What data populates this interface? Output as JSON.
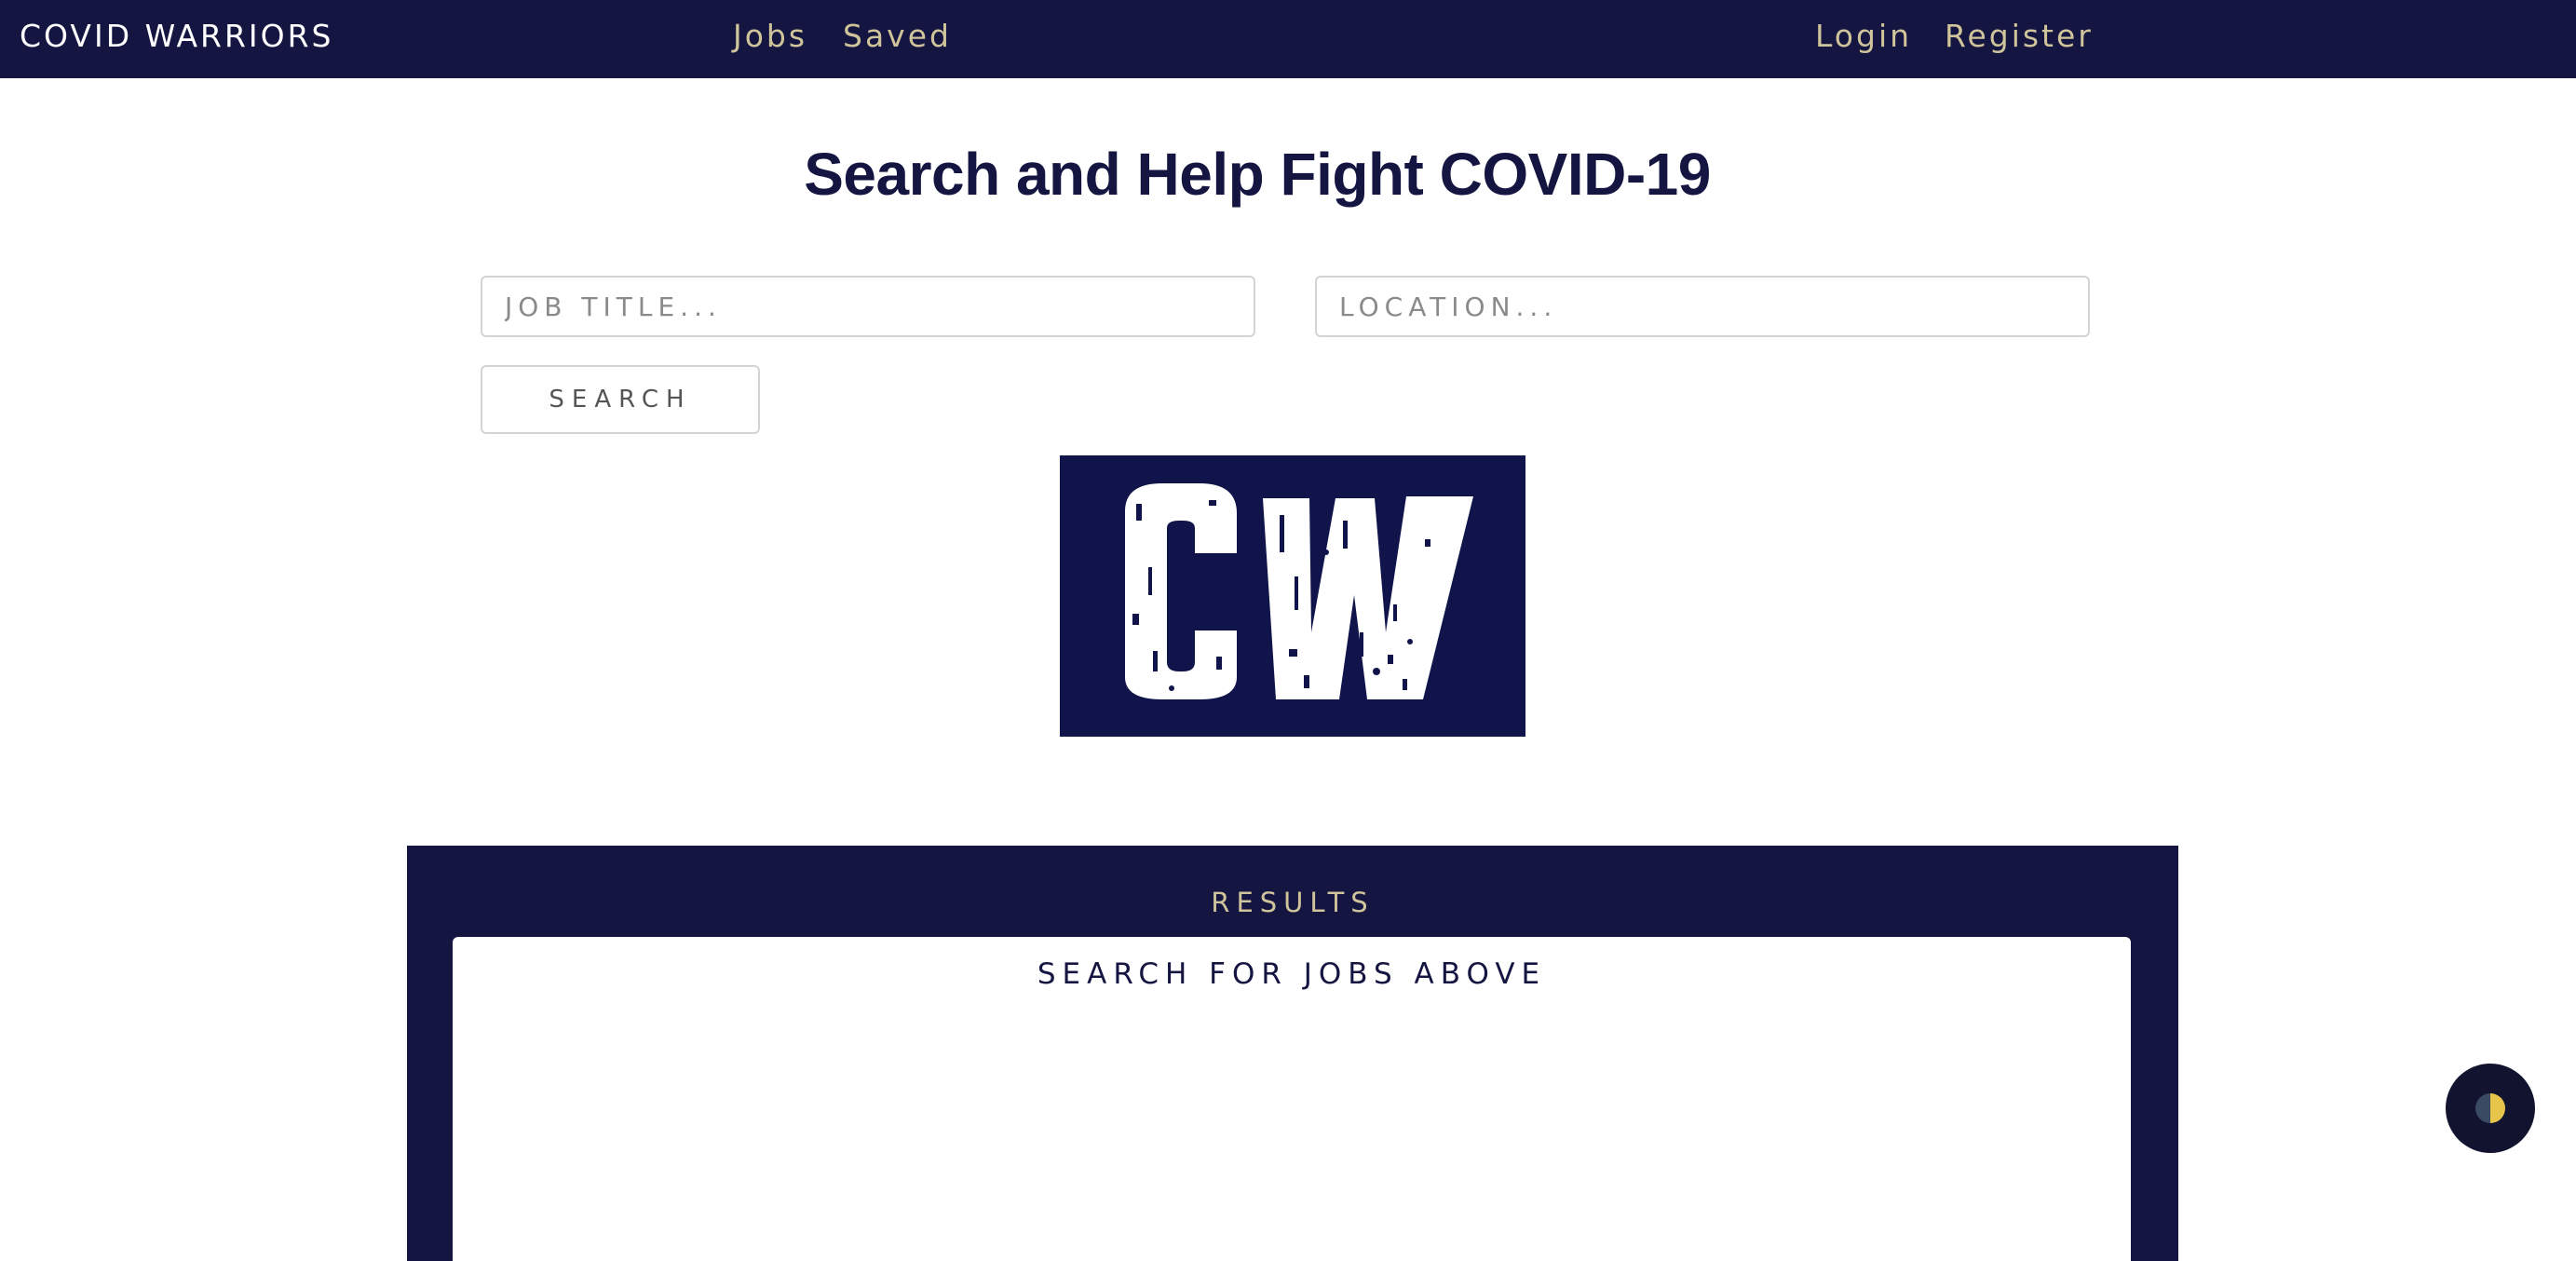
{
  "navbar": {
    "brand": "COVID WARRIORS",
    "links": {
      "jobs": "Jobs",
      "saved": "Saved",
      "login": "Login",
      "register": "Register"
    }
  },
  "main": {
    "title": "Search and Help Fight COVID-19",
    "search": {
      "job_title_placeholder": "JOB TITLE...",
      "location_placeholder": "LOCATION...",
      "button_label": "SEARCH"
    },
    "logo_text": "CW"
  },
  "results": {
    "heading": "RESULTS",
    "empty_message": "SEARCH FOR JOBS ABOVE"
  },
  "theme_toggle": {
    "icon": "half-moon-icon"
  },
  "colors": {
    "navy": "#151542",
    "gold": "#cfc49a",
    "toggle_yellow": "#e7c54a"
  }
}
